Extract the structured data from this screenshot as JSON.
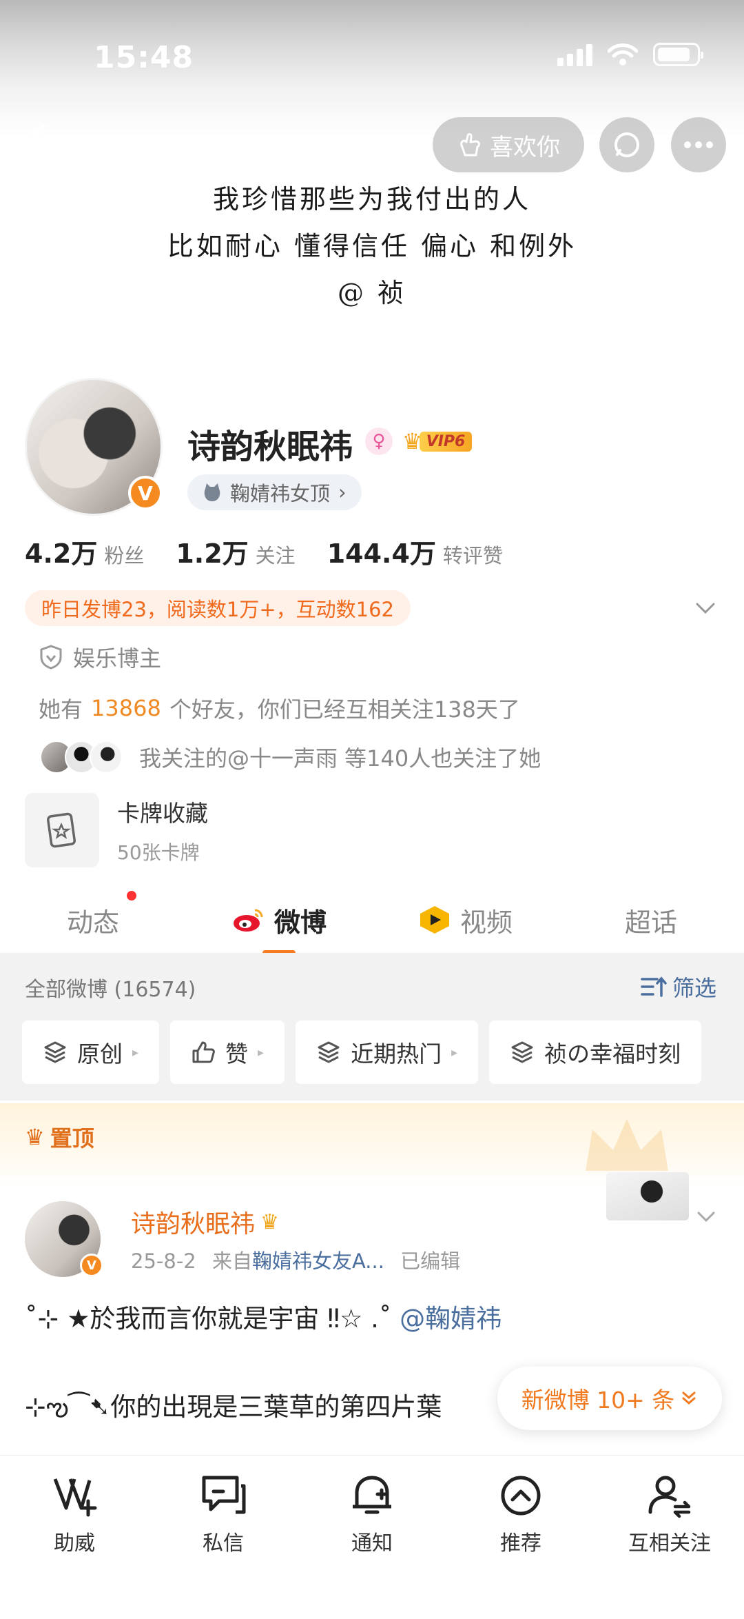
{
  "status_bar": {
    "time": "15:48"
  },
  "top_nav": {
    "like_label": "喜欢你"
  },
  "banner": {
    "lines": [
      "我珍惜那些为我付出的人",
      "比如耐心 懂得信任 偏心 和例外",
      "@ 祯"
    ]
  },
  "profile": {
    "name": "诗韵秋眠祎",
    "vip_label": "VIP6",
    "fan_group": "鞠婧祎女顶",
    "stats": [
      {
        "value": "4.2万",
        "label": "粉丝"
      },
      {
        "value": "1.2万",
        "label": "关注"
      },
      {
        "value": "144.4万",
        "label": "转评赞"
      }
    ],
    "activity": "昨日发博23，阅读数1万+，互动数162",
    "role": "娱乐博主",
    "friends_prefix": "她有",
    "friends_count": "13868",
    "friends_suffix": "个好友，你们已经互相关注138天了",
    "mutual_follow": "我关注的@十一声雨 等140人也关注了她",
    "card": {
      "title": "卡牌收藏",
      "subtitle": "50张卡牌"
    }
  },
  "tabs": [
    {
      "label": "动态"
    },
    {
      "label": "微博"
    },
    {
      "label": "视频"
    },
    {
      "label": "超话"
    }
  ],
  "feed_filter": {
    "title": "全部微博 (16574)",
    "filter_label": "筛选",
    "chips": [
      "原创",
      "赞",
      "近期热门",
      "祯の幸福时刻"
    ]
  },
  "pinned": {
    "label": "置顶",
    "post": {
      "author": "诗韵秋眠祎",
      "date": "25-8-2",
      "source_prefix": "来自",
      "source": "鞠婧祎女友A...",
      "edited": "已编辑",
      "line1_text": "˚⊹ ★於我而言你就是宇宙 ‼☆ .˚",
      "line1_mention": "@鞠婧祎",
      "line2_text": "⊹ఌ⁀➷你的出現是三葉草的第四片葉"
    }
  },
  "new_posts_toast": "新微博 10+ 条",
  "bottom_nav": [
    {
      "label": "助威",
      "icon": "cheer-icon"
    },
    {
      "label": "私信",
      "icon": "message-icon"
    },
    {
      "label": "通知",
      "icon": "bell-icon"
    },
    {
      "label": "推荐",
      "icon": "recommend-icon"
    },
    {
      "label": "互相关注",
      "icon": "mutual-follow-icon"
    }
  ],
  "colors": {
    "accent": "#f57c24",
    "link": "#4a6e9e",
    "highlight": "#f08a24"
  }
}
